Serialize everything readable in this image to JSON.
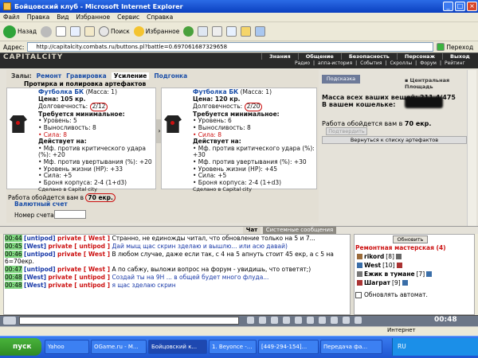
{
  "window": {
    "title": "Бойцовский клуб - Microsoft Internet Explorer"
  },
  "menu": [
    "Файл",
    "Правка",
    "Вид",
    "Избранное",
    "Сервис",
    "Справка"
  ],
  "toolbar": {
    "back": "Назад",
    "search": "Поиск",
    "favorites": "Избранное"
  },
  "address": {
    "label": "Адрес:",
    "url": "http://capitalcity.combats.ru/buttons.pl?battle=0.697061687329658",
    "go": "Переход"
  },
  "site": {
    "logo": "CAPITALCITY",
    "nav_main": [
      "Знания",
      "Общение",
      "Безопасность",
      "Персонаж",
      "Выход"
    ],
    "nav_sub": [
      "Радио",
      "аппа-история",
      "События",
      "Скроллы",
      "Форум",
      "Рейтинг"
    ]
  },
  "workshop": {
    "tabs": [
      "Залы:",
      "Ремонт",
      "Гравировка",
      "Усиление",
      "Подгонка"
    ],
    "active_tab": "Усиление",
    "subtab": "Протирка и полировка артефактов",
    "left_item": {
      "name": "Футболка БК",
      "mass": "(Масса: 1)",
      "price": "Цена: 105 кр.",
      "durability_label": "Долговечность:",
      "durability": "2/12",
      "req_title": "Требуется минимальное:",
      "req": [
        "• Уровень: 5",
        "• Выносливость: 8"
      ],
      "req_red": "• Сила: 8",
      "acts_title": "Действует на:",
      "acts": [
        "• Мф. против критического удара (%): +20",
        "• Мф. против увертывания (%): +20",
        "• Уровень жизни (HP): +33",
        "• Сила: +5",
        "• Броня корпуса: 2-4 (1+d3)"
      ],
      "made": "Сделано в Capital city"
    },
    "right_item": {
      "name": "Футболка БК",
      "mass": "(Масса: 1)",
      "price": "Цена: 120 кр.",
      "durability_label": "Долговечность:",
      "durability": "2/20",
      "req_title": "Требуется минимальное:",
      "req": [
        "• Уровень: 6",
        "• Выносливость: 8"
      ],
      "req_red": "• Сила: 8",
      "acts_title": "Действует на:",
      "acts": [
        "• Мф. против критического удара (%): +30",
        "• Мф. против увертывания (%): +30",
        "• Уровень жизни (HP): +45",
        "• Сила: +5",
        "• Броня корпуса: 2-4 (1+d3)"
      ],
      "made": "Сделано в Capital city"
    },
    "cost_prefix": "Работа обойдется вам в",
    "cost_value": "70 екр.",
    "currency_account": "Валютный счет",
    "account_label": "Номер счета"
  },
  "info": {
    "hint_button": "Подсказка",
    "square_link": "Центральная Площадь",
    "mass_line1": "Масса всех ваших вещей: 211.4/475",
    "mass_line2": "В вашем кошельке:",
    "cost_prefix": "Работа обойдется вам в",
    "cost_value": "70 екр.",
    "confirm": "Подтвердить",
    "back": "Вернуться к списку артефактов"
  },
  "chat": {
    "tab_chat": "Чат",
    "tab_system": "Системные сообщения",
    "lines": [
      {
        "time": "00:44",
        "user": "[untipod]",
        "priv": "private [ West ]",
        "text": "Странно, не единожды читал, что обновление только на 5 и 7...",
        "blue": false
      },
      {
        "time": "00:45",
        "user": "[West]",
        "priv": "private [ untipod ]",
        "text": "Дай мыщ щас скрин зделаю и вышлю... или асю давай)",
        "blue": true
      },
      {
        "time": "00:46",
        "user": "[untipod]",
        "priv": "private [ West ]",
        "text": "В любом случае, даже если так, с 4 на 5 апнуть стоит 45 екр, а с 5 на",
        "blue": false
      },
      {
        "time": "",
        "user": "",
        "priv": "",
        "text": "6=70екр.",
        "blue": false
      },
      {
        "time": "00:47",
        "user": "[untipod]",
        "priv": "private [ West ]",
        "text": "А по сабжу, выложи вопрос на форум - увидишь, что ответят;)",
        "blue": false
      },
      {
        "time": "00:48",
        "user": "[West]",
        "priv": "private [ untipod ]",
        "text": "Создай ты на 9Н ... в общей будет много флуда...",
        "blue": true
      },
      {
        "time": "00:48",
        "user": "[West]",
        "priv": "private [ untipod ]",
        "text": "я щас зделаю скрин",
        "blue": true
      }
    ]
  },
  "users": {
    "refresh": "Обновить",
    "room": "Ремонтная мастерская (4)",
    "list": [
      {
        "name": "rikord",
        "level": "[8]"
      },
      {
        "name": "West",
        "level": "[10]"
      },
      {
        "name": "Ежик в тумане",
        "level": "[7]"
      },
      {
        "name": "Шаграт",
        "level": "[9]"
      }
    ],
    "auto_refresh": "Обновлять автомат."
  },
  "bottom": {
    "clock": "00:48"
  },
  "status": {
    "zone": "Интернет"
  },
  "taskbar": {
    "start": "пуск",
    "tasks": [
      "Yahoo",
      "OGame.ru - M...",
      "Бойцовский к...",
      "1. Beyonce -...",
      "[449-294-154]...",
      "Передача фа..."
    ],
    "tray": "RU"
  }
}
